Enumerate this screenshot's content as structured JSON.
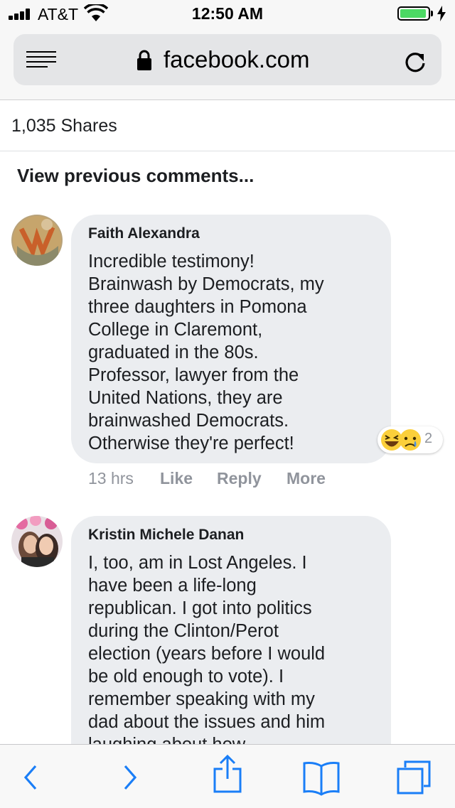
{
  "status": {
    "carrier": "AT&T",
    "time": "12:50 AM",
    "battery_color": "#4cd964"
  },
  "browser": {
    "url": "facebook.com",
    "icons": [
      "reader-mode-icon",
      "lock-icon",
      "reload-icon"
    ]
  },
  "post": {
    "shares": "1,035 Shares",
    "view_previous": "View previous comments..."
  },
  "comments": [
    {
      "author": "Faith Alexandra",
      "text": "Incredible testimony!\nBrainwash by Democrats, my\nthree daughters in Pomona\nCollege in Claremont,\ngraduated in the 80s.\nProfessor, lawyer from the\nUnited Nations, they are\nbrainwashed Democrats.\nOtherwise they're perfect!",
      "reactions": {
        "count": "2",
        "icons": [
          "haha-reaction-icon",
          "sad-reaction-icon"
        ]
      },
      "time": "13 hrs",
      "like_label": "Like",
      "reply_label": "Reply",
      "more_label": "More"
    },
    {
      "author": "Kristin Michele Danan",
      "text": "I, too, am in Lost Angeles. I\nhave been a life-long\nrepublican. I got into politics\nduring the Clinton/Perot\nelection (years before I would\nbe old enough to vote). I\nremember speaking with my\ndad about the issues and him\nlaughing about how..."
    }
  ],
  "toolbar": {
    "icons": [
      "back-icon",
      "forward-icon",
      "share-icon",
      "bookmarks-icon",
      "tabs-icon"
    ],
    "accent": "#1a7ef7"
  },
  "colors": {
    "bubble": "#ebedf0",
    "meta_text": "#90949c"
  }
}
